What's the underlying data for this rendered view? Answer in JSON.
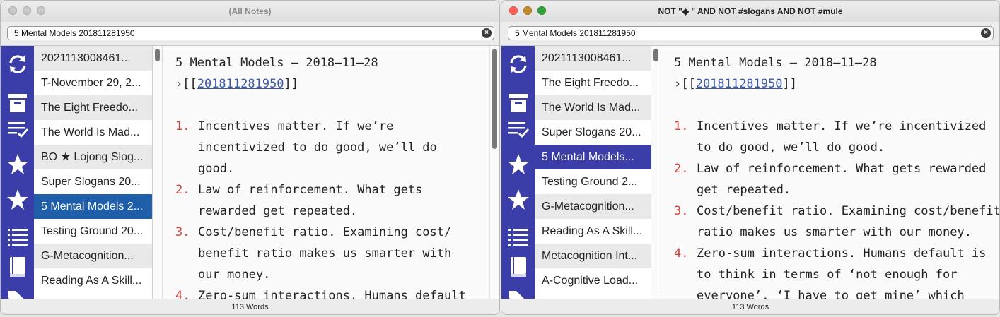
{
  "colors": {
    "accent_sidebar": "#3b3da8",
    "selected_left": "#1f5fa9",
    "selected_right": "#3b3da8",
    "list_number": "#d9413c",
    "link": "#3a58a8",
    "traffic_close": "#ff5f57",
    "traffic_minimize": "#c08b2c",
    "traffic_zoom": "#31a33a",
    "traffic_inactive": "#c9c9c9"
  },
  "sidebar_icons": [
    "sync-icon",
    "archive-box-icon",
    "checklist-icon",
    "star-icon",
    "star-icon",
    "list-icon",
    "book-icon",
    "tag-icon"
  ],
  "left_window": {
    "title": "(All Notes)",
    "search_value": "5 Mental Models 201811281950",
    "notes": [
      "2021113008461...",
      "T-November 29, 2...",
      "The Eight Freedo...",
      "The World Is Mad...",
      "BO ★ Lojong Slog...",
      "Super Slogans 20...",
      "5 Mental Models 2...",
      "Testing Ground 20...",
      "G-Metacognition...",
      "Reading As A Skill..."
    ],
    "selected_index": 6,
    "status": "113 Words",
    "editor": {
      "heading": "5 Mental Models – 2018–11–28",
      "link_prefix": "›[[",
      "link_text": "201811281950",
      "link_suffix": "]]",
      "items": [
        {
          "num": "1.",
          "lines": [
            "Incentives matter. If we’re",
            "incentivized to do good, we’ll do",
            "good."
          ]
        },
        {
          "num": "2.",
          "lines": [
            "Law of reinforcement. What gets",
            "rewarded get repeated."
          ]
        },
        {
          "num": "3.",
          "lines": [
            "Cost/benefit ratio. Examining cost/",
            "benefit ratio makes us smarter with",
            "our money."
          ]
        },
        {
          "num": "4.",
          "lines": [
            "Zero-sum interactions. Humans default"
          ]
        }
      ]
    }
  },
  "right_window": {
    "title": "NOT \"◆ \" AND NOT #slogans AND NOT #mule",
    "search_value": "5 Mental Models 201811281950",
    "notes": [
      "2021113008461...",
      "The Eight Freedo...",
      "The World Is Mad...",
      "Super Slogans 20...",
      "5 Mental Models...",
      "Testing Ground 2...",
      "G-Metacognition...",
      "Reading As A Skill...",
      "Metacognition Int...",
      "A-Cognitive Load..."
    ],
    "selected_index": 4,
    "status": "113 Words",
    "editor": {
      "heading": "5 Mental Models – 2018–11–28",
      "link_prefix": "›[[",
      "link_text": "201811281950",
      "link_suffix": "]]",
      "items": [
        {
          "num": "1.",
          "lines": [
            "Incentives matter. If we’re incentivized",
            "to do good, we’ll do good."
          ]
        },
        {
          "num": "2.",
          "lines": [
            "Law of reinforcement. What gets rewarded",
            "get repeated."
          ]
        },
        {
          "num": "3.",
          "lines": [
            "Cost/benefit ratio. Examining cost/benefit",
            "ratio makes us smarter with our money."
          ]
        },
        {
          "num": "4.",
          "lines": [
            "Zero-sum interactions. Humans default is",
            "to think in terms of ‘not enough for",
            "everyone’, ‘I have to get mine’ which"
          ]
        }
      ]
    }
  }
}
